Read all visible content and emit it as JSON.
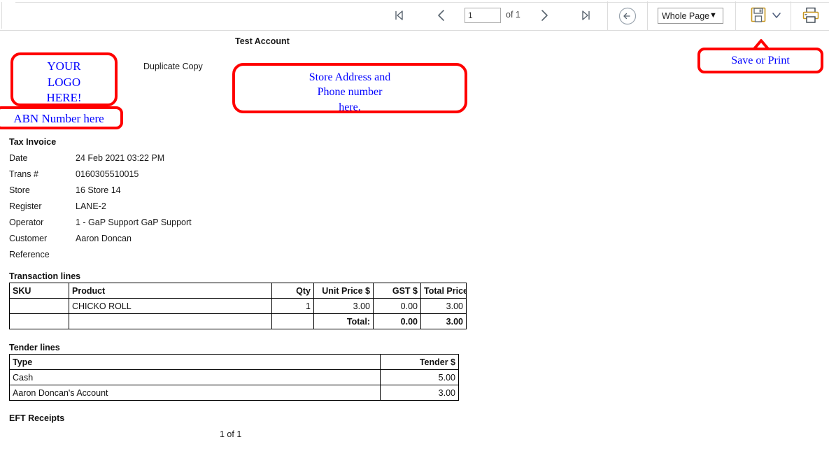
{
  "toolbar": {
    "first_page_label": "First page",
    "prev_page_label": "Previous page",
    "page_number_value": "1",
    "page_of_label": "of 1",
    "next_page_label": "Next page",
    "last_page_label": "Last page",
    "back_label": "Back",
    "zoom_selected": "Whole Page",
    "zoom_options": [
      "Whole Page"
    ],
    "save_label": "Save",
    "save_dropdown_label": "Save options",
    "print_label": "Print",
    "icons": {
      "first": "first-page-icon",
      "prev": "previous-page-icon",
      "next": "next-page-icon",
      "last": "last-page-icon",
      "back": "back-circle-arrow-icon",
      "zoom_chevron": "chevron-down-icon",
      "save": "floppy-disk-save-icon",
      "save_caret": "chevron-down-icon",
      "print": "printer-icon"
    }
  },
  "annotations": {
    "logo": "YOUR\nLOGO\nHERE!",
    "logo_lines": [
      "YOUR",
      "LOGO",
      "HERE!"
    ],
    "abn": "ABN Number here",
    "address_lines": [
      "Store Address and",
      "Phone number",
      "here."
    ],
    "save_or_print": "Save or Print",
    "border_color": "#ff0000",
    "text_color": "#0000ff"
  },
  "document": {
    "account_title": "Test Account",
    "duplicate_copy": "Duplicate Copy",
    "invoice_heading": "Tax Invoice",
    "details": [
      {
        "label": "Date",
        "value": "24 Feb 2021 03:22 PM"
      },
      {
        "label": "Trans #",
        "value": "0160305510015"
      },
      {
        "label": "Store",
        "value": "16 Store 14"
      },
      {
        "label": "Register",
        "value": "LANE-2"
      },
      {
        "label": "Operator",
        "value": "1 - GaP Support GaP Support"
      },
      {
        "label": "Customer",
        "value": " Aaron Doncan"
      },
      {
        "label": "Reference",
        "value": ""
      }
    ],
    "transaction_heading": "Transaction lines",
    "transaction_columns": [
      "SKU",
      "Product",
      "Qty",
      "Unit Price $",
      "GST $",
      "Total Price $"
    ],
    "transaction_rows": [
      {
        "sku": "",
        "product": "CHICKO ROLL",
        "qty": "1",
        "unit_price": "3.00",
        "gst": "0.00",
        "total_price": "3.00"
      }
    ],
    "transaction_total": {
      "label": "Total:",
      "gst": "0.00",
      "total_price": "3.00"
    },
    "tender_heading": "Tender lines",
    "tender_columns": [
      "Type",
      "Tender $"
    ],
    "tender_rows": [
      {
        "type": "Cash",
        "amount": "5.00"
      },
      {
        "type": "Aaron Doncan's Account",
        "amount": "3.00"
      }
    ],
    "eft_heading": "EFT Receipts",
    "footer_pages": "1 of 1"
  }
}
